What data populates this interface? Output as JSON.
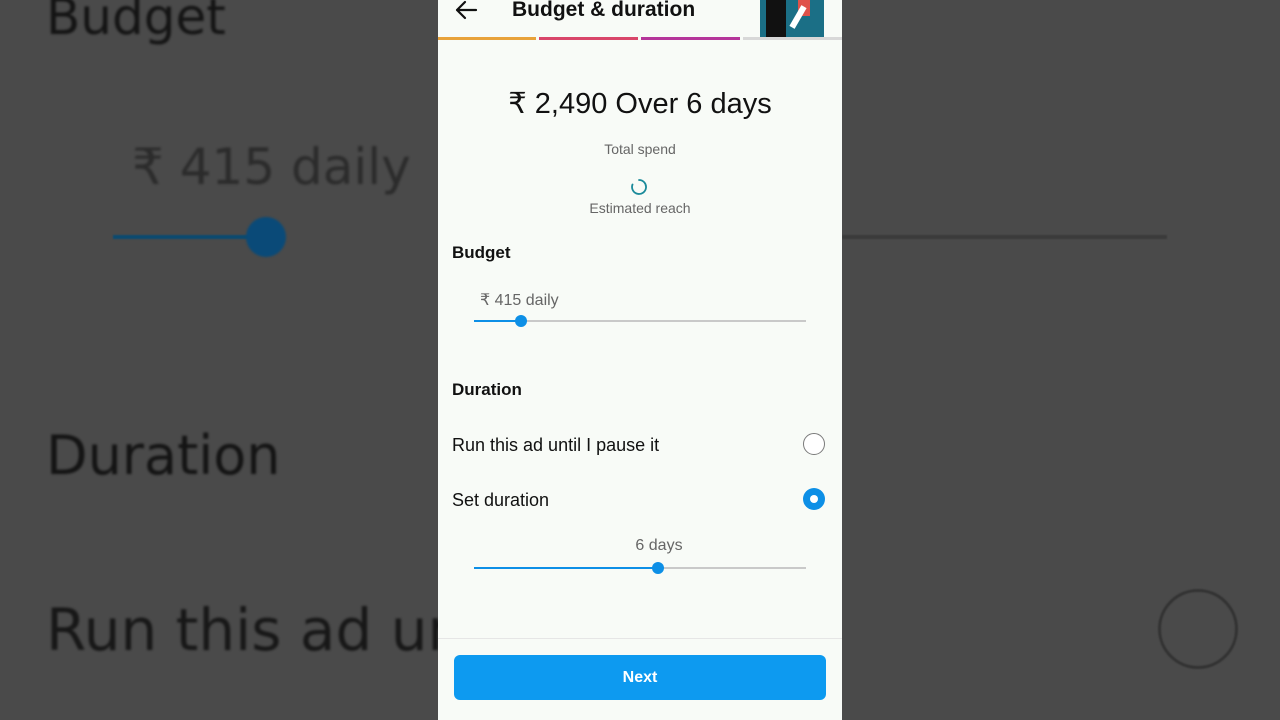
{
  "background_echo": {
    "budget": "Budget",
    "daily": "₹ 415 daily",
    "duration": "Duration",
    "run": "Run this ad unt"
  },
  "header": {
    "title": "Budget & duration",
    "back_icon": "arrow-left-icon",
    "progress_colors": [
      "#e8a23a",
      "#d9466a",
      "#b5359a",
      "#d8d8d8"
    ]
  },
  "summary": {
    "total": "₹ 2,490 Over 6 days",
    "total_label": "Total spend",
    "reach_icon": "loading-spinner-icon",
    "reach_label": "Estimated reach"
  },
  "budget": {
    "title": "Budget",
    "value": "₹ 415 daily",
    "slider_fraction": 0.143
  },
  "duration": {
    "title": "Duration",
    "options": [
      {
        "label": "Run this ad until I pause it",
        "selected": false
      },
      {
        "label": "Set duration",
        "selected": true
      }
    ],
    "value": "6 days",
    "slider_fraction": 0.553
  },
  "footer": {
    "next_label": "Next"
  },
  "colors": {
    "accent": "#0d9af0"
  }
}
